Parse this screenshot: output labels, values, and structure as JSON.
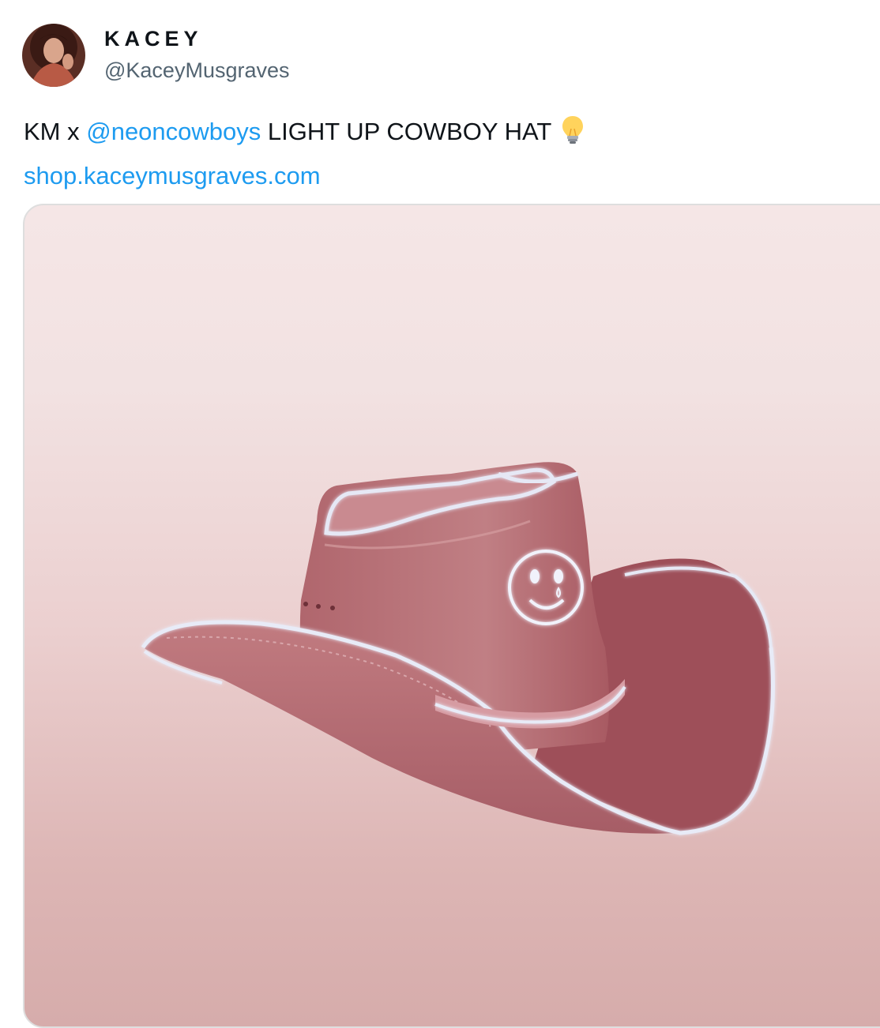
{
  "author": {
    "display_name": "KACEY",
    "handle": "@KaceyMusgraves",
    "avatar_icon": "profile-photo"
  },
  "tweet": {
    "text_prefix": "KM x ",
    "mention": "@neoncowboys",
    "text_suffix": " LIGHT UP COWBOY HAT",
    "emoji_icon": "light-bulb-icon",
    "link": "shop.kaceymusgraves.com"
  },
  "media": {
    "subject": "pink light-up cowboy hat with smiley face",
    "colors": {
      "background_top": "#f5e6e6",
      "background_bottom": "#d6acab",
      "hat": "#b86f74",
      "glow": "#dfe3f2"
    }
  },
  "colors": {
    "link": "#1d9bf0",
    "text": "#0f1419",
    "secondary_text": "#536471"
  }
}
